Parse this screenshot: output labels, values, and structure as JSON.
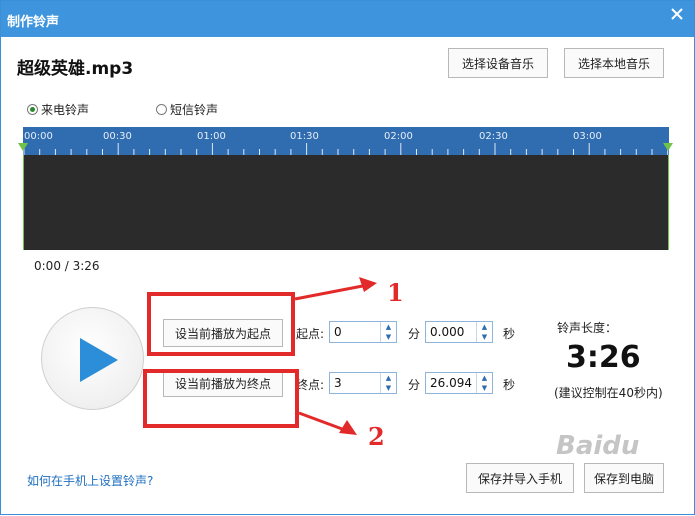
{
  "window": {
    "title": "制作铃声"
  },
  "song": {
    "name": "超级英雄.mp3"
  },
  "buttons": {
    "select_device_music": "选择设备音乐",
    "select_local_music": "选择本地音乐",
    "set_start": "设当前播放为起点",
    "set_end": "设当前播放为终点",
    "save_import_phone": "保存并导入手机",
    "save_to_pc": "保存到电脑"
  },
  "ringtype": {
    "options": [
      "来电铃声",
      "短信铃声"
    ],
    "selected": "来电铃声"
  },
  "timeline": {
    "ticks": [
      "00:00",
      "00:30",
      "01:00",
      "01:30",
      "02:00",
      "02:30",
      "03:00"
    ]
  },
  "playback": {
    "position": "0:00 / 3:26"
  },
  "start_point": {
    "label": "起点:",
    "minutes": "0",
    "min_unit": "分",
    "seconds": "0.000",
    "sec_unit": "秒"
  },
  "end_point": {
    "label": "终点:",
    "minutes": "3",
    "min_unit": "分",
    "seconds": "26.094",
    "sec_unit": "秒"
  },
  "ringtone_length": {
    "label": "铃声长度：",
    "value": "3:26",
    "hint": "(建议控制在40秒内)"
  },
  "help": {
    "link": "如何在手机上设置铃声?"
  },
  "annotations": {
    "one": "1",
    "two": "2"
  },
  "watermark": {
    "text": "Baidu"
  },
  "colors": {
    "title_bar": "#3f95dd",
    "timeline": "#2f6cb0",
    "annotation_red": "#e32a2a",
    "marker_green": "#6fc24a"
  }
}
